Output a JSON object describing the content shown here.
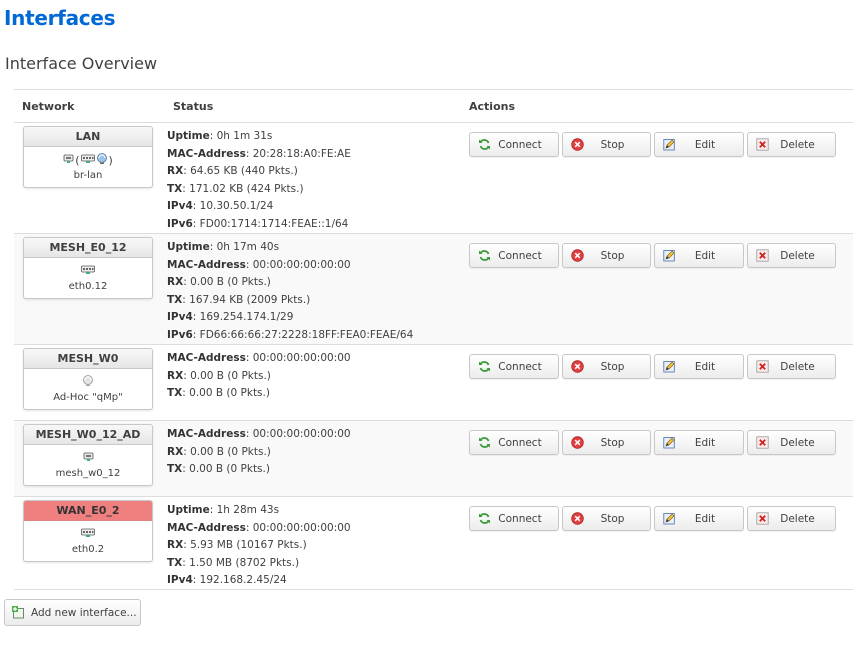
{
  "page": {
    "title": "Interfaces",
    "section": "Interface Overview"
  },
  "table": {
    "col_network": "Network",
    "col_status": "Status",
    "col_actions": "Actions"
  },
  "actions": {
    "connect": "Connect",
    "stop": "Stop",
    "edit": "Edit",
    "delete": "Delete"
  },
  "add_button": "Add new interface...",
  "colors": {
    "title": "#0069d6",
    "down_badge": "#f08080"
  },
  "interfaces": [
    {
      "name": "LAN",
      "state": "up",
      "icons": [
        "ethernet-icon",
        "paren-open",
        "switch-icon",
        "wifi-icon",
        "paren-close"
      ],
      "paren_open": "(",
      "paren_close": ")",
      "device": "br-lan",
      "status": [
        {
          "label": "Uptime",
          "value": "0h 1m 31s"
        },
        {
          "label": "MAC-Address",
          "value": "20:28:18:A0:FE:AE"
        },
        {
          "label": "RX",
          "value": "64.65 KB (440 Pkts.)"
        },
        {
          "label": "TX",
          "value": "171.02 KB (424 Pkts.)"
        },
        {
          "label": "IPv4",
          "value": "10.30.50.1/24"
        },
        {
          "label": "IPv6",
          "value": "FD00:1714:1714:FEAE::1/64"
        }
      ]
    },
    {
      "name": "MESH_E0_12",
      "state": "up",
      "icons": [
        "switch-icon"
      ],
      "device": "eth0.12",
      "status": [
        {
          "label": "Uptime",
          "value": "0h 17m 40s"
        },
        {
          "label": "MAC-Address",
          "value": "00:00:00:00:00:00"
        },
        {
          "label": "RX",
          "value": "0.00 B (0 Pkts.)"
        },
        {
          "label": "TX",
          "value": "167.94 KB (2009 Pkts.)"
        },
        {
          "label": "IPv4",
          "value": "169.254.174.1/29"
        },
        {
          "label": "IPv6",
          "value": "FD66:66:66:27:2228:18FF:FEA0:FEAE/64"
        }
      ]
    },
    {
      "name": "MESH_W0",
      "state": "up",
      "icons": [
        "wifi-disabled-icon"
      ],
      "device": "Ad-Hoc \"qMp\"",
      "status": [
        {
          "label": "MAC-Address",
          "value": "00:00:00:00:00:00"
        },
        {
          "label": "RX",
          "value": "0.00 B (0 Pkts.)"
        },
        {
          "label": "TX",
          "value": "0.00 B (0 Pkts.)"
        }
      ]
    },
    {
      "name": "MESH_W0_12_AD",
      "state": "up",
      "icons": [
        "ethernet-icon"
      ],
      "device": "mesh_w0_12",
      "status": [
        {
          "label": "MAC-Address",
          "value": "00:00:00:00:00:00"
        },
        {
          "label": "RX",
          "value": "0.00 B (0 Pkts.)"
        },
        {
          "label": "TX",
          "value": "0.00 B (0 Pkts.)"
        }
      ]
    },
    {
      "name": "WAN_E0_2",
      "state": "down",
      "icons": [
        "switch-icon"
      ],
      "device": "eth0.2",
      "status": [
        {
          "label": "Uptime",
          "value": "1h 28m 43s"
        },
        {
          "label": "MAC-Address",
          "value": "00:00:00:00:00:00"
        },
        {
          "label": "RX",
          "value": "5.93 MB (10167 Pkts.)"
        },
        {
          "label": "TX",
          "value": "1.50 MB (8702 Pkts.)"
        },
        {
          "label": "IPv4",
          "value": "192.168.2.45/24"
        }
      ]
    }
  ]
}
